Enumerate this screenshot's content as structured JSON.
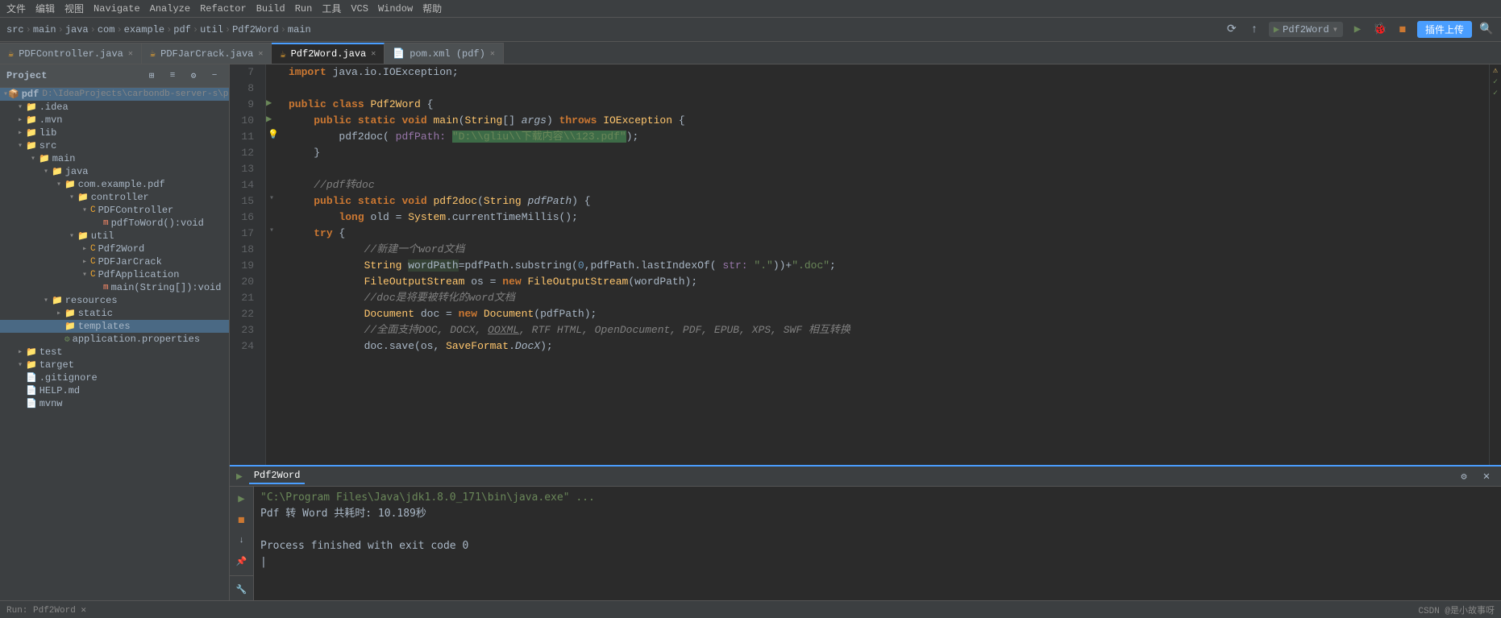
{
  "menubar": {
    "items": [
      "File",
      "Edit",
      "View",
      "Navigate",
      "Analyze",
      "Refactor",
      "Build",
      "Run",
      "Tools",
      "VCS",
      "Window",
      "Help"
    ]
  },
  "toolbar": {
    "breadcrumb": [
      "src",
      "main",
      "java",
      "com",
      "example",
      "pdf",
      "util",
      "Pdf2Word",
      "main"
    ],
    "run_config": "Pdf2Word",
    "upload_btn": "插件上传"
  },
  "tabs": [
    {
      "id": "pdf-controller",
      "label": "PDFController.java",
      "icon": "java",
      "active": false,
      "modified": false
    },
    {
      "id": "pdf-jar-crack",
      "label": "PDFJarCrack.java",
      "icon": "java",
      "active": false,
      "modified": false
    },
    {
      "id": "pdf2word",
      "label": "Pdf2Word.java",
      "icon": "java",
      "active": true,
      "modified": false
    },
    {
      "id": "pom-xml",
      "label": "pom.xml (pdf)",
      "icon": "xml",
      "active": false,
      "modified": false
    }
  ],
  "sidebar": {
    "project_label": "Project",
    "tree": [
      {
        "level": 0,
        "expanded": true,
        "label": "pdf",
        "prefix": "D:\\IdeaProjects\\carbondb-server-s\\pdf",
        "icon": "module"
      },
      {
        "level": 1,
        "expanded": true,
        "label": ".idea",
        "icon": "folder"
      },
      {
        "level": 1,
        "expanded": false,
        "label": ".mvn",
        "icon": "folder"
      },
      {
        "level": 1,
        "expanded": false,
        "label": "lib",
        "icon": "folder"
      },
      {
        "level": 1,
        "expanded": true,
        "label": "src",
        "icon": "folder"
      },
      {
        "level": 2,
        "expanded": true,
        "label": "main",
        "icon": "folder"
      },
      {
        "level": 3,
        "expanded": true,
        "label": "java",
        "icon": "folder"
      },
      {
        "level": 4,
        "expanded": true,
        "label": "com.example.pdf",
        "icon": "folder"
      },
      {
        "level": 5,
        "expanded": true,
        "label": "controller",
        "icon": "folder"
      },
      {
        "level": 6,
        "expanded": true,
        "label": "PDFController",
        "icon": "java"
      },
      {
        "level": 7,
        "label": "pdfToWord():void",
        "icon": "method"
      },
      {
        "level": 5,
        "expanded": true,
        "label": "util",
        "icon": "folder"
      },
      {
        "level": 6,
        "expanded": true,
        "label": "Pdf2Word",
        "icon": "java"
      },
      {
        "level": 6,
        "expanded": false,
        "label": "PDFJarCrack",
        "icon": "java"
      },
      {
        "level": 6,
        "expanded": true,
        "label": "PdfApplication",
        "icon": "java"
      },
      {
        "level": 7,
        "label": "main(String[]):void",
        "icon": "method"
      },
      {
        "level": 3,
        "expanded": true,
        "label": "resources",
        "icon": "folder"
      },
      {
        "level": 4,
        "expanded": false,
        "label": "static",
        "icon": "folder"
      },
      {
        "level": 4,
        "label": "templates",
        "icon": "folder",
        "selected": true
      },
      {
        "level": 4,
        "label": "application.properties",
        "icon": "properties"
      },
      {
        "level": 1,
        "expanded": false,
        "label": "test",
        "icon": "folder"
      },
      {
        "level": 1,
        "expanded": true,
        "label": "target",
        "icon": "folder"
      },
      {
        "level": 1,
        "label": ".gitignore",
        "icon": "file"
      },
      {
        "level": 1,
        "label": "HELP.md",
        "icon": "file"
      },
      {
        "level": 1,
        "label": "mvnw",
        "icon": "file"
      }
    ]
  },
  "code": {
    "lines": [
      {
        "num": 7,
        "content": "import java.io.IOException;",
        "type": "import"
      },
      {
        "num": 8,
        "content": "",
        "type": "blank"
      },
      {
        "num": 9,
        "content": "public class Pdf2Word {",
        "type": "class"
      },
      {
        "num": 10,
        "content": "    public static void main(String[] args) throws IOException {",
        "type": "method"
      },
      {
        "num": 11,
        "content": "        pdf2doc( pdfPath: \"D:\\\\gliu\\\\下载内容\\\\123.pdf\");",
        "type": "call-hl"
      },
      {
        "num": 12,
        "content": "    }",
        "type": "brace"
      },
      {
        "num": 13,
        "content": "",
        "type": "blank"
      },
      {
        "num": 14,
        "content": "    //pdf转doc",
        "type": "comment"
      },
      {
        "num": 15,
        "content": "    public static void pdf2doc(String pdfPath) {",
        "type": "method2"
      },
      {
        "num": 16,
        "content": "        long old = System.currentTimeMillis();",
        "type": "code"
      },
      {
        "num": 17,
        "content": "    try {",
        "type": "try"
      },
      {
        "num": 18,
        "content": "            //新建一个word文档",
        "type": "comment"
      },
      {
        "num": 19,
        "content": "            String wordPath=pdfPath.substring(0,pdfPath.lastIndexOf( str: \".\"))+\".doc\";",
        "type": "code"
      },
      {
        "num": 20,
        "content": "            FileOutputStream os = new FileOutputStream(wordPath);",
        "type": "code"
      },
      {
        "num": 21,
        "content": "            //doc是将要被转化的word文档",
        "type": "comment"
      },
      {
        "num": 22,
        "content": "            Document doc = new Document(pdfPath);",
        "type": "code"
      },
      {
        "num": 23,
        "content": "            //全面支持DOC, DOCX, OOXML, RTF HTML, OpenDocument, PDF, EPUB, XPS, SWF 相互转换",
        "type": "comment"
      },
      {
        "num": 24,
        "content": "            doc.save(os, SaveFormat.DocX);",
        "type": "code"
      }
    ]
  },
  "run_panel": {
    "tab_label": "Pdf2Word",
    "command": "\"C:\\Program Files\\Java\\jdk1.8.0_171\\bin\\java.exe\" ...",
    "output_lines": [
      "Pdf 转 Word 共耗时: 10.189秒",
      "",
      "Process finished with exit code 0"
    ],
    "cursor": "|"
  },
  "status_bar": {
    "right_items": [
      "CSDN @是小故事呀"
    ]
  }
}
